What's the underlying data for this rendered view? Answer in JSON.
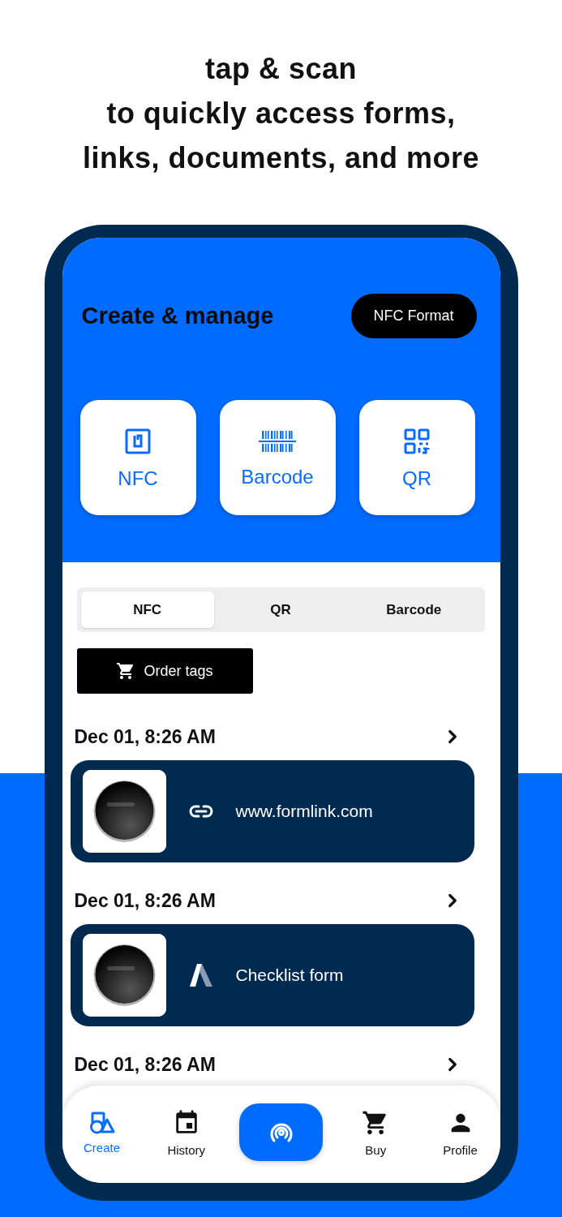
{
  "headline": [
    "tap & scan",
    "to quickly access forms,",
    "links, documents, and more"
  ],
  "header": {
    "title": "Create & manage",
    "format_button": "NFC Format"
  },
  "create_cards": [
    {
      "kind": "nfc",
      "label": "NFC"
    },
    {
      "kind": "barcode",
      "label": "Barcode"
    },
    {
      "kind": "qr",
      "label": "QR"
    }
  ],
  "tabs": [
    {
      "label": "NFC",
      "selected": true
    },
    {
      "label": "QR",
      "selected": false
    },
    {
      "label": "Barcode",
      "selected": false
    }
  ],
  "order_button": "Order tags",
  "entries": [
    {
      "date": "Dec 01, 8:26 AM",
      "kind": "link",
      "label": "www.formlink.com"
    },
    {
      "date": "Dec 01, 8:26 AM",
      "kind": "form",
      "label": "Checklist form"
    },
    {
      "date": "Dec 01, 8:26 AM"
    }
  ],
  "nav": [
    {
      "kind": "create",
      "label": "Create",
      "selected": true
    },
    {
      "kind": "history",
      "label": "History",
      "selected": false
    },
    {
      "kind": "scan",
      "selected": false
    },
    {
      "kind": "buy",
      "label": "Buy",
      "selected": false
    },
    {
      "kind": "profile",
      "label": "Profile",
      "selected": false
    }
  ]
}
